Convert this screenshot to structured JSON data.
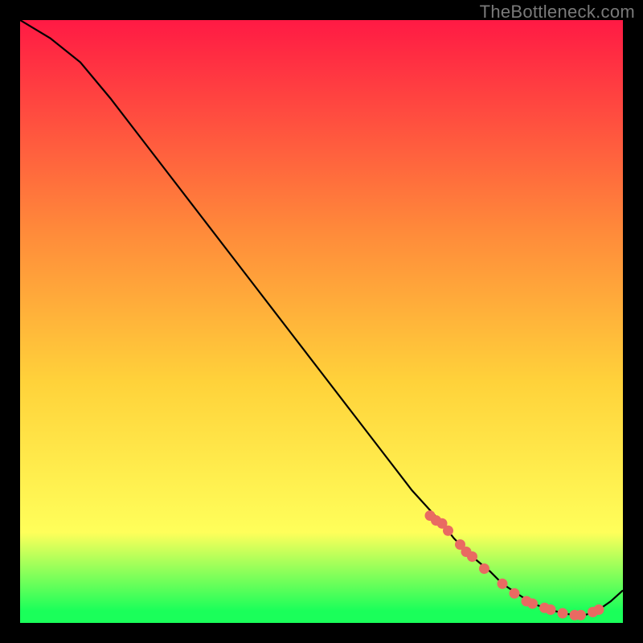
{
  "watermark": "TheBottleneck.com",
  "colors": {
    "bg_black": "#000000",
    "grad_top": "#ff1a44",
    "grad_mid1": "#ff8a3a",
    "grad_mid2": "#ffd23a",
    "grad_mid3": "#ffff5a",
    "grad_bottom": "#1aff5a",
    "curve": "#000000",
    "marker_fill": "#e96a62",
    "marker_stroke": "#d9574f"
  },
  "chart_data": {
    "type": "line",
    "title": "",
    "xlabel": "",
    "ylabel": "",
    "xlim": [
      0,
      100
    ],
    "ylim": [
      0,
      100
    ],
    "grid": false,
    "legend": false,
    "series": [
      {
        "name": "bottleneck-curve",
        "x": [
          0,
          5,
          10,
          15,
          20,
          25,
          30,
          35,
          40,
          45,
          50,
          55,
          60,
          65,
          70,
          72,
          75,
          78,
          80,
          83,
          85,
          88,
          90,
          92,
          94,
          96,
          98,
          100
        ],
        "y": [
          100,
          97,
          93,
          87,
          80.5,
          74,
          67.5,
          61,
          54.5,
          48,
          41.5,
          35,
          28.5,
          22,
          16.5,
          14,
          11,
          8.5,
          6.5,
          4.5,
          3.2,
          2.2,
          1.6,
          1.3,
          1.4,
          2.2,
          3.6,
          5.4
        ]
      }
    ],
    "markers": {
      "name": "highlight-points",
      "x": [
        68,
        69,
        70,
        71,
        73,
        74,
        75,
        77,
        80,
        82,
        84,
        85,
        87,
        88,
        90,
        92,
        93,
        95,
        96
      ],
      "y": [
        17.8,
        17.0,
        16.5,
        15.3,
        13.0,
        11.8,
        11.0,
        9.0,
        6.5,
        4.9,
        3.6,
        3.2,
        2.5,
        2.2,
        1.6,
        1.3,
        1.3,
        1.8,
        2.2
      ]
    }
  }
}
